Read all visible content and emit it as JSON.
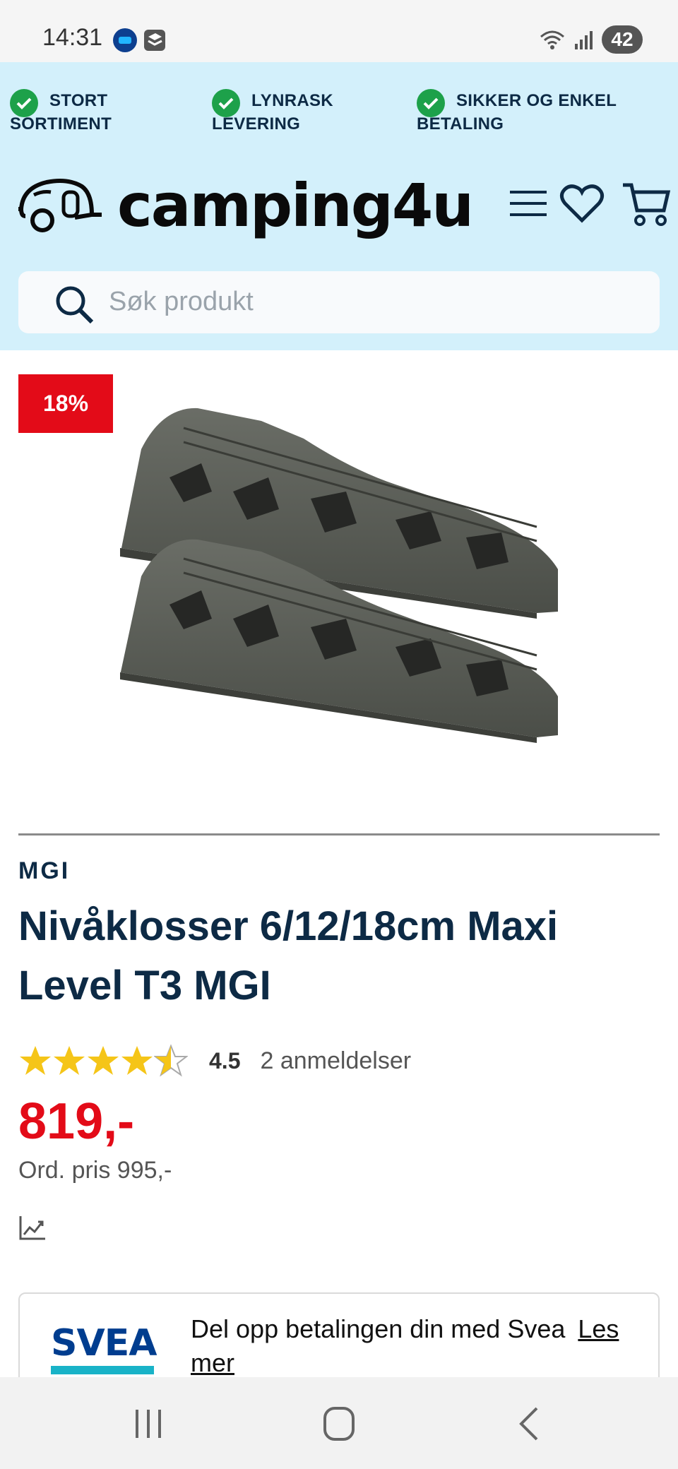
{
  "status_bar": {
    "time": "14:31",
    "battery": "42",
    "icons": [
      "app-icon-1",
      "app-icon-2",
      "wifi-icon",
      "signal-icon",
      "battery-icon"
    ]
  },
  "usps": [
    {
      "line1": "STORT",
      "line2": "SORTIMENT"
    },
    {
      "line1": "LYNRASK",
      "line2": "LEVERING"
    },
    {
      "line1": "SIKKER OG ENKEL",
      "line2": "BETALING"
    }
  ],
  "logo": {
    "text": "camping4u"
  },
  "header_icons": [
    "menu-icon",
    "heart-icon",
    "cart-icon"
  ],
  "search": {
    "placeholder": "Søk produkt"
  },
  "product": {
    "discount_badge": "18%",
    "brand": "MGI",
    "title": "Nivåklosser 6/12/18cm Maxi Level T3 MGI",
    "rating_value": "4.5",
    "rating_fraction": 0.9,
    "reviews": "2 anmeldelser",
    "price": "819,-",
    "ordinary_price": "Ord. pris 995,-"
  },
  "svea": {
    "logo": "SVEA",
    "text": "Del opp betalingen din med Svea",
    "link": "Les mer"
  },
  "colors": {
    "header_bg": "#d3f0fb",
    "navy": "#0d2a45",
    "red": "#e30b18",
    "green": "#1da14a",
    "star": "#f5c518"
  }
}
